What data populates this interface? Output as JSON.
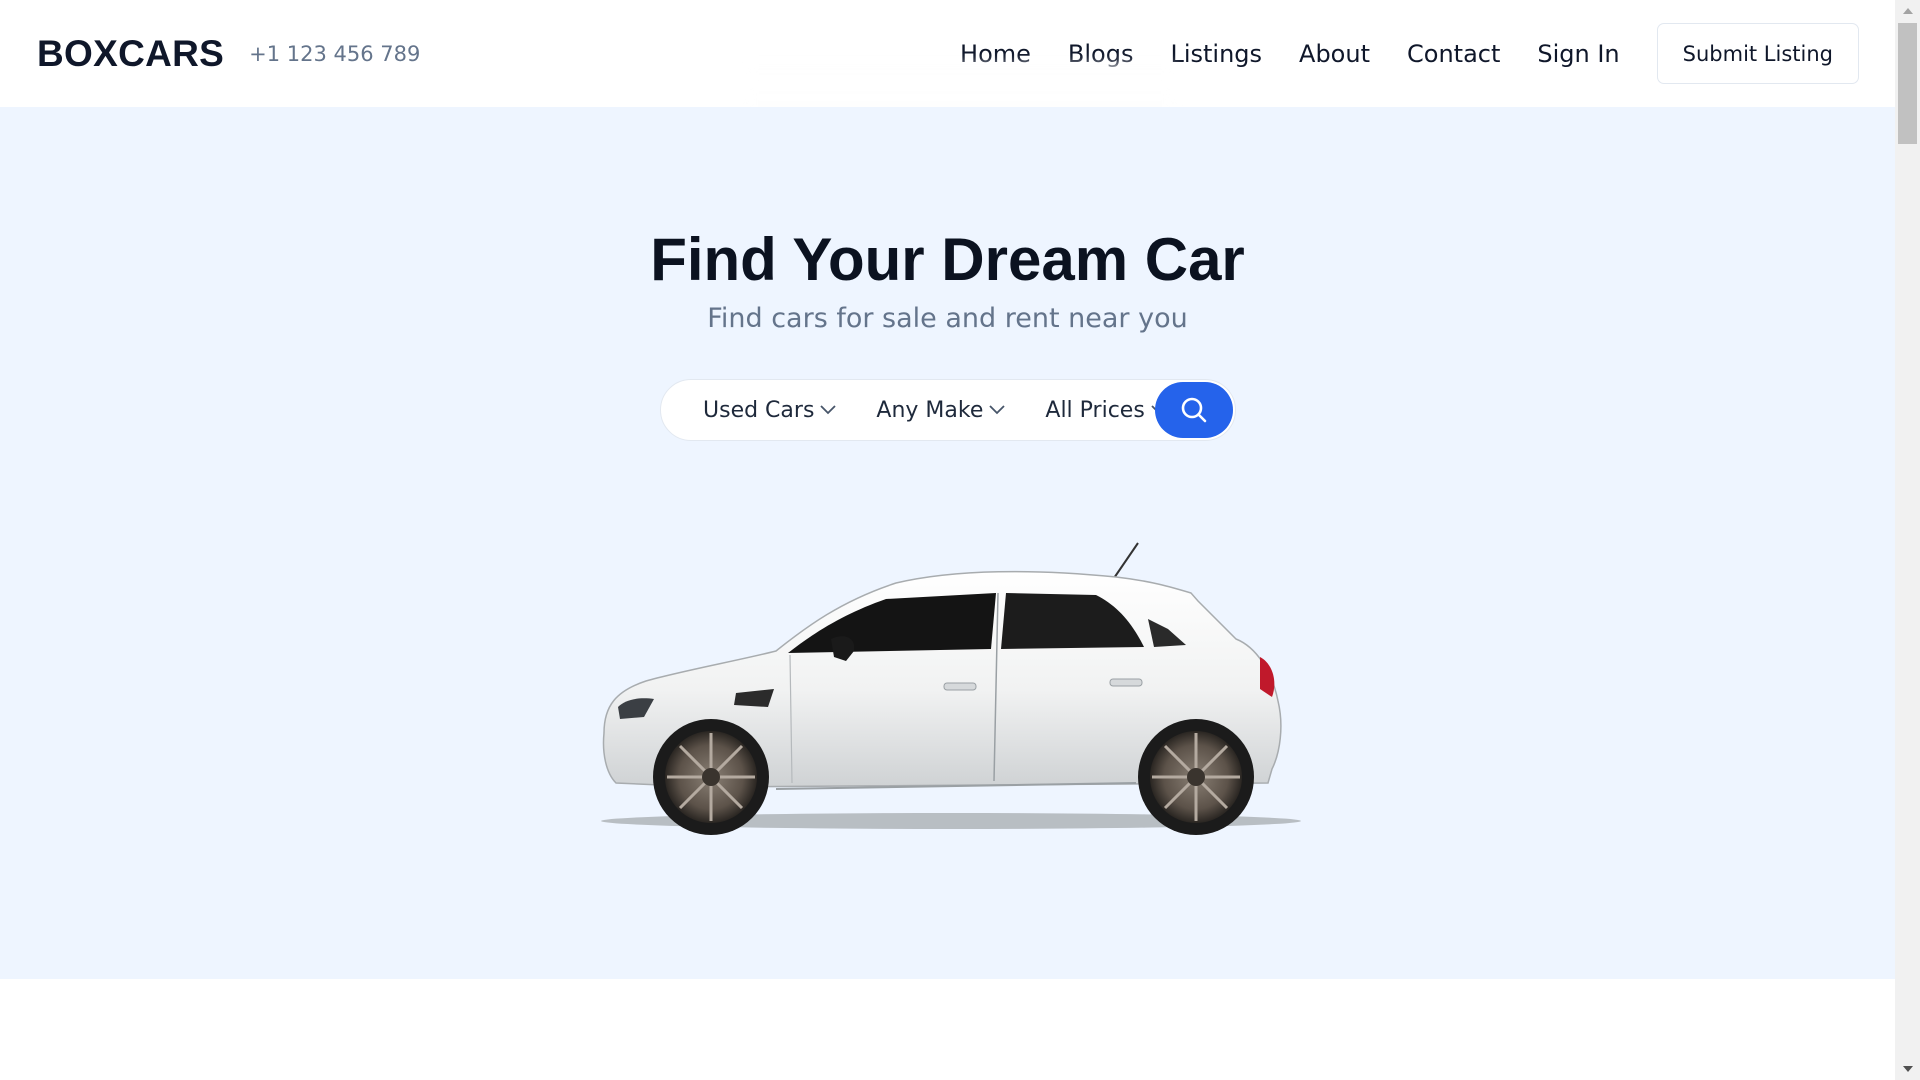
{
  "header": {
    "brand": "BOXCARS",
    "phone": "+1 123 456 789",
    "nav": {
      "home": "Home",
      "blogs": "Blogs",
      "listings": "Listings",
      "about": "About",
      "contact": "Contact",
      "sign_in": "Sign In"
    },
    "submit_label": "Submit Listing"
  },
  "hero": {
    "title": "Find Your Dream Car",
    "subtitle": "Find cars for sale and rent near you",
    "search": {
      "condition": "Used Cars",
      "make": "Any Make",
      "price": "All Prices",
      "button_icon": "search-icon"
    },
    "image_icon": "car-image"
  },
  "colors": {
    "hero_bg": "#eef5ff",
    "accent": "#2563eb",
    "text_dark": "#0f172a",
    "text_muted": "#64748b"
  }
}
